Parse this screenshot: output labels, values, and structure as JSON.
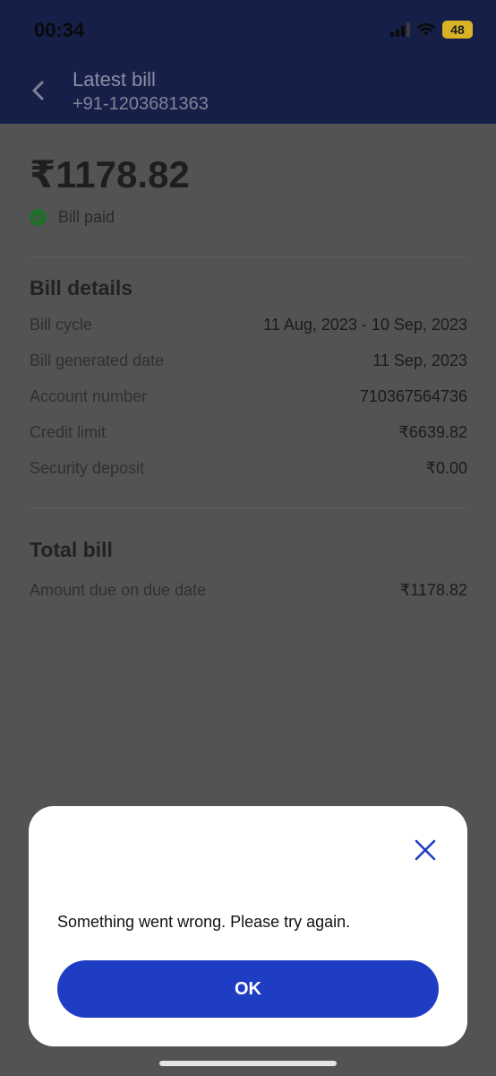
{
  "status_bar": {
    "time": "00:34",
    "battery": "48"
  },
  "header": {
    "title": "Latest bill",
    "subtitle": "+91-1203681363"
  },
  "summary": {
    "amount": "₹1178.82",
    "status": "Bill paid",
    "status_color": "#2e9e3f"
  },
  "bill_details": {
    "title": "Bill details",
    "rows": [
      {
        "label": "Bill cycle",
        "value": "11 Aug, 2023 - 10 Sep, 2023"
      },
      {
        "label": "Bill generated date",
        "value": "11 Sep, 2023"
      },
      {
        "label": "Account number",
        "value": "710367564736"
      },
      {
        "label": "Credit limit",
        "value": "₹6639.82"
      },
      {
        "label": "Security deposit",
        "value": "₹0.00"
      }
    ]
  },
  "total_bill": {
    "title": "Total bill",
    "rows": [
      {
        "label": "Amount due on due date",
        "value": "₹1178.82"
      }
    ]
  },
  "modal": {
    "message": "Something went wrong. Please try again.",
    "ok_label": "OK",
    "accent_color": "#1f3dc2"
  }
}
